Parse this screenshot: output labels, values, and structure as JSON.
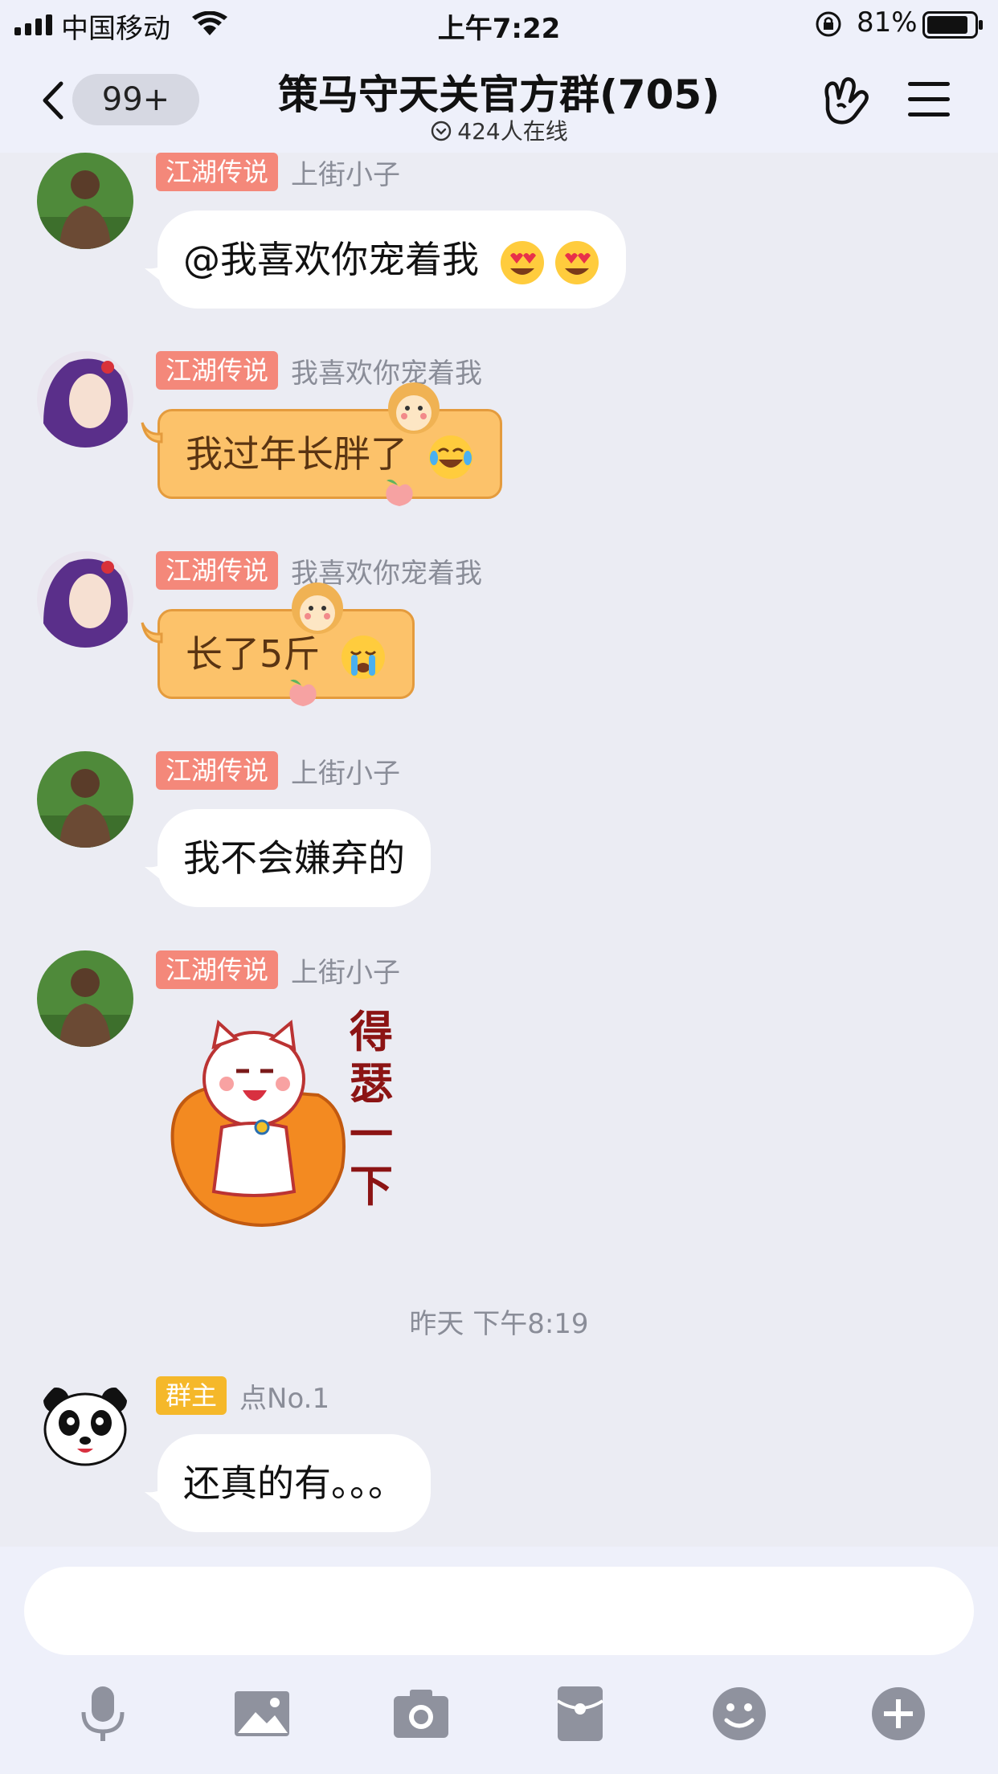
{
  "status_bar": {
    "carrier": "中国移动",
    "time": "上午7:22",
    "battery": "81%"
  },
  "nav": {
    "back_badge": "99+",
    "title": "策马守天关官方群(705)",
    "online": "424人在线"
  },
  "messages": [
    {
      "tag": "江湖传说",
      "nick": "上街小子",
      "text": "@我喜欢你宠着我",
      "avatar": "athlete-avatar"
    },
    {
      "tag": "江湖传说",
      "nick": "我喜欢你宠着我",
      "text": "我过年长胖了",
      "avatar": "anime-girl-avatar"
    },
    {
      "tag": "江湖传说",
      "nick": "我喜欢你宠着我",
      "text": "长了5斤",
      "avatar": "anime-girl-avatar"
    },
    {
      "tag": "江湖传说",
      "nick": "上街小子",
      "text": "我不会嫌弃的",
      "avatar": "athlete-avatar"
    },
    {
      "tag": "江湖传说",
      "nick": "上街小子",
      "sticker_text": [
        "得",
        "瑟",
        "一",
        "下"
      ],
      "avatar": "athlete-avatar"
    },
    {
      "tag": "群主",
      "nick": "点No.1",
      "text": "还真的有。。。",
      "avatar": "panda-avatar"
    }
  ],
  "timestamp": "昨天 下午8:19",
  "colors": {
    "background": "#ebecf3",
    "tag_red": "#f4887a",
    "tag_gold": "#f5b82a",
    "bubble_orange": "#fcc26a"
  },
  "toolbar": [
    "microphone-icon",
    "image-icon",
    "camera-icon",
    "red-packet-icon",
    "emoji-icon",
    "plus-icon"
  ]
}
